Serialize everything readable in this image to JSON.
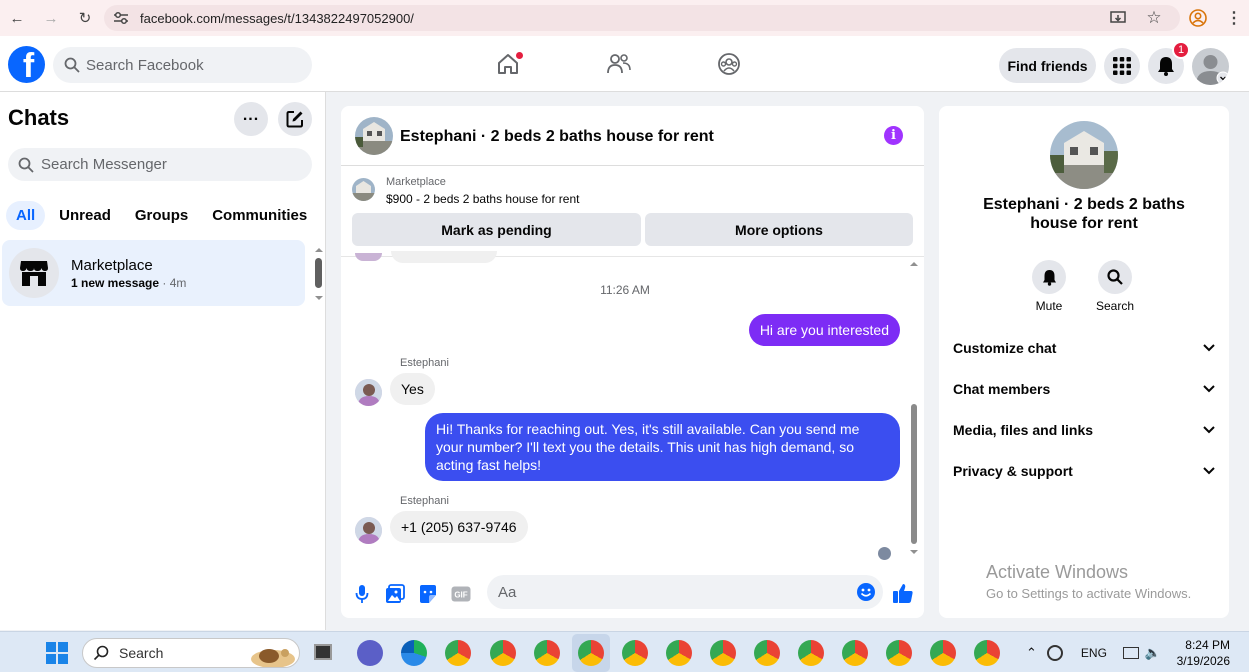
{
  "browser": {
    "url": "facebook.com/messages/t/1343822497052900/"
  },
  "header": {
    "search_placeholder": "Search Facebook",
    "find_friends": "Find friends",
    "notif_count": "1"
  },
  "left": {
    "title": "Chats",
    "search_placeholder": "Search Messenger",
    "filters": [
      "All",
      "Unread",
      "Groups",
      "Communities"
    ],
    "chat": {
      "name": "Marketplace",
      "status": "1 new message",
      "time": " · 4m"
    }
  },
  "conversation": {
    "title": "Estephani · 2 beds 2 baths house for rent",
    "marketplace_label": "Marketplace",
    "listing": "$900 - 2 beds 2 baths house for rent",
    "mark_pending": "Mark as pending",
    "more_options": "More options",
    "timestamp": "11:26 AM",
    "messages": [
      {
        "from": "me",
        "text": "Hi are you interested"
      },
      {
        "from": "Estephani",
        "sender": "Estephani",
        "text": "Yes"
      },
      {
        "from": "me",
        "text": "Hi! Thanks for reaching out. Yes, it's still available. Can you send me your number? I'll text you the details. This unit has high demand, so acting fast helps!"
      },
      {
        "from": "Estephani",
        "sender": "Estephani",
        "text": "+1 (205) 637-9746"
      }
    ],
    "composer_placeholder": "Aa"
  },
  "right": {
    "name": "Estephani · 2 beds 2 baths house for rent",
    "actions": [
      "Mute",
      "Search"
    ],
    "sections": [
      "Customize chat",
      "Chat members",
      "Media, files and links",
      "Privacy & support"
    ],
    "watermark_title": "Activate Windows",
    "watermark_sub": "Go to Settings to activate Windows."
  },
  "taskbar": {
    "search_placeholder": "Search",
    "lang": "ENG",
    "time": "8:24 PM",
    "date": "3/19/2026"
  },
  "colors": {
    "accent": "#0866ff",
    "bubble_out_purple": "#7d2cf5",
    "bubble_out_blue": "#3b4ef0",
    "info": "#a033ff"
  }
}
